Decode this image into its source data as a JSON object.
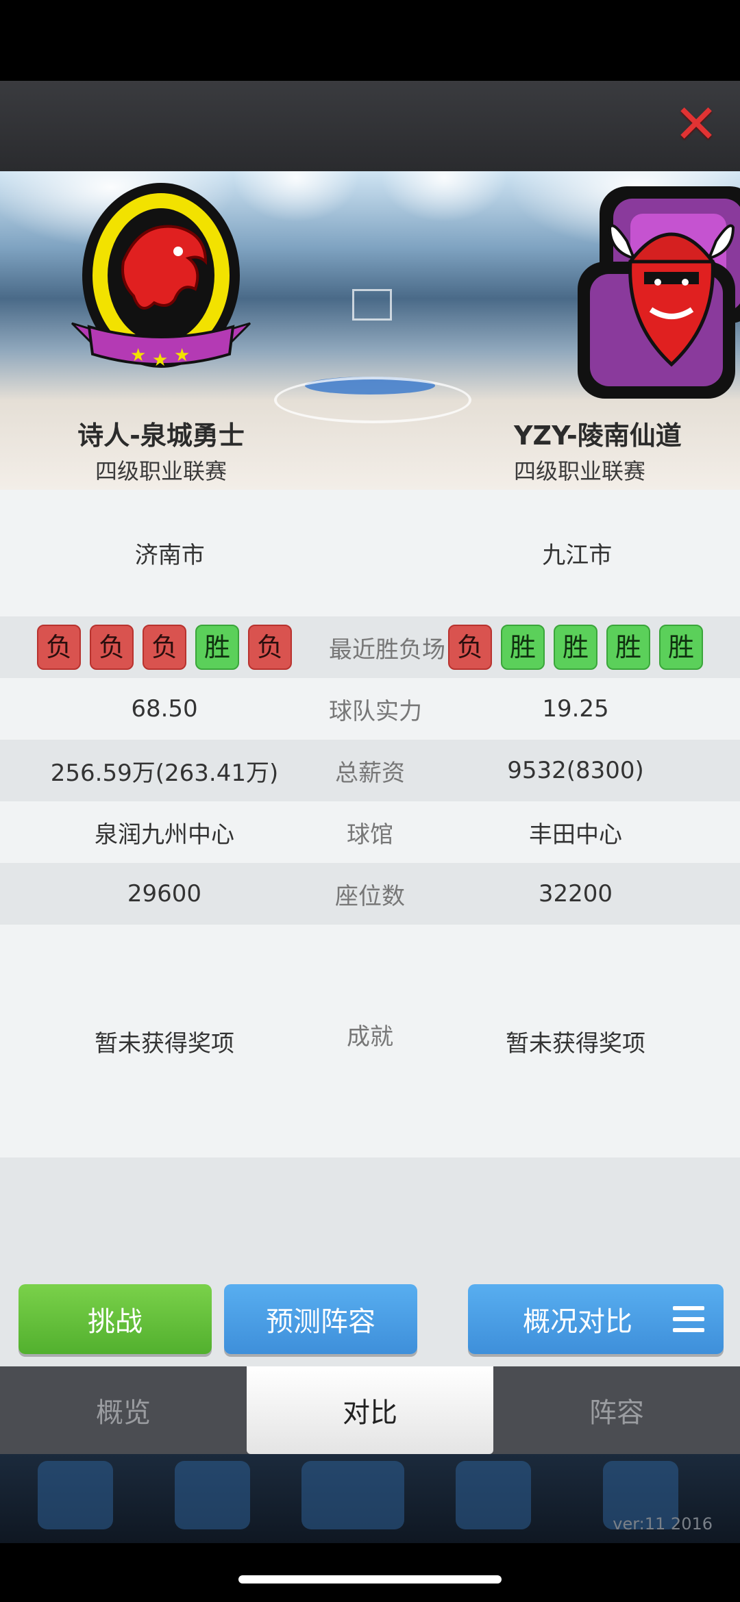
{
  "close_label": "✕",
  "home": {
    "name": "诗人-泉城勇士",
    "league": "四级职业联赛",
    "city": "济南市",
    "results": [
      "负",
      "负",
      "负",
      "胜",
      "负"
    ],
    "strength": "68.50",
    "salary": "256.59万(263.41万)",
    "arena": "泉润九州中心",
    "seats": "29600",
    "achievement": "暂未获得奖项"
  },
  "away": {
    "name": "YZY-陵南仙道",
    "league": "四级职业联赛",
    "city": "九江市",
    "results": [
      "负",
      "胜",
      "胜",
      "胜",
      "胜"
    ],
    "strength": "19.25",
    "salary": "9532(8300)",
    "arena": "丰田中心",
    "seats": "32200",
    "achievement": "暂未获得奖项"
  },
  "labels": {
    "recent": "最近胜负场",
    "strength": "球队实力",
    "salary": "总薪资",
    "arena": "球馆",
    "seats": "座位数",
    "achievement": "成就"
  },
  "buttons": {
    "challenge": "挑战",
    "predict": "预测阵容",
    "compare": "概况对比"
  },
  "tabs": [
    "概览",
    "对比",
    "阵容"
  ],
  "active_tab": "对比",
  "version": "ver:11  2016",
  "colors": {
    "win": "#5bd05a",
    "loss": "#d9534f",
    "challenge": "#6cc53f",
    "primary": "#4a9de6",
    "close": "#e23333"
  },
  "icons": {
    "close": "close-icon",
    "menu": "menu-icon",
    "home_logo": "dragon-logo",
    "away_logo": "viking-logo"
  }
}
